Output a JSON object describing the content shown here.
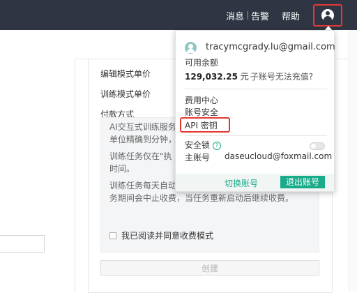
{
  "topbar": {
    "messages": "消息",
    "alarm": "告警",
    "help": "帮助",
    "user_icon": "user-icon"
  },
  "form": {
    "edit_mode_price": "编辑模式单价",
    "train_mode_price": "训练模式单价",
    "payment_method": "付款方式",
    "info_lines": [
      "AI交互式训练服务",
      "单位精确到分钟，",
      "训练任务仅在\"执",
      "时间。",
      "训练任务每天自动结算当天运行时间。用户停止任",
      "务期间会中止收费，当任务重新启动后继续收费。"
    ],
    "agree_label": "我已阅读并同意收费模式",
    "create_button": "创建"
  },
  "dropdown": {
    "email": "tracymcgrady.lu@gmail.com",
    "balance_label": "可用余额",
    "balance_value": "129,032.25",
    "balance_unit": "元",
    "recharge_note": "子账号无法充值?",
    "menu": {
      "billing": "费用中心",
      "security": "账号安全",
      "api_key": "API 密钥"
    },
    "security_lock": "安全锁",
    "security_lock_enabled": false,
    "main_account_label": "主账号",
    "main_account_value": "daseucloud@foxmail.com",
    "switch_account": "切换账号",
    "logout": "退出账号"
  },
  "colors": {
    "topbar_bg": "#2f3542",
    "accent_green": "#1aab8a",
    "highlight_red": "#e53935"
  }
}
